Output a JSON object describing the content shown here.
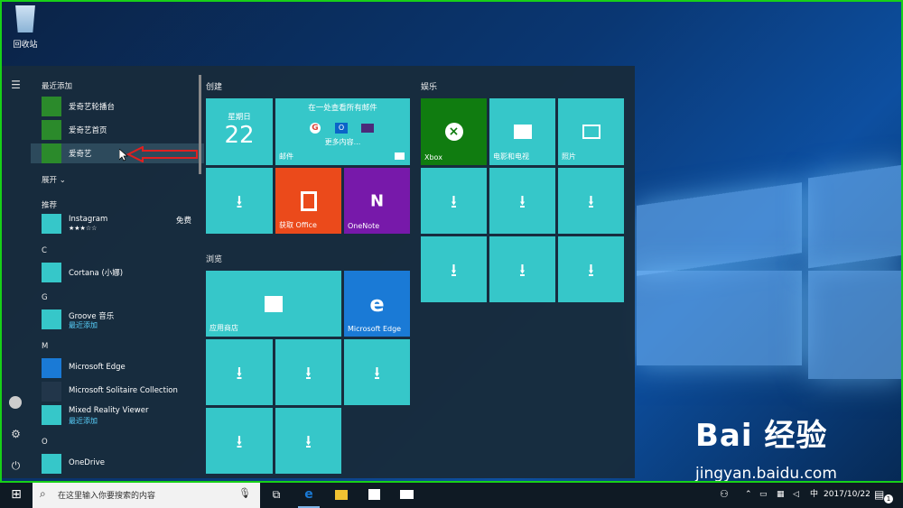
{
  "desktop": {
    "recycle_bin": "回收站"
  },
  "start_menu": {
    "recent_header": "最近添加",
    "recent_apps": [
      {
        "name": "爱奇艺轮播台"
      },
      {
        "name": "爱奇艺首页"
      },
      {
        "name": "爱奇艺"
      }
    ],
    "expand": "展开",
    "recommended_header": "推荐",
    "instagram": {
      "name": "Instagram",
      "price": "免费",
      "stars": "★★★☆☆"
    },
    "section_c": "C",
    "cortana": "Cortana (小娜)",
    "section_g": "G",
    "groove": {
      "name": "Groove 音乐",
      "sub": "最近添加"
    },
    "section_m": "M",
    "edge": "Microsoft Edge",
    "solitaire": "Microsoft Solitaire Collection",
    "mixed_reality": {
      "name": "Mixed Reality Viewer",
      "sub": "最近添加"
    },
    "section_o": "O",
    "onedrive": "OneDrive"
  },
  "tiles": {
    "group_create": "创建",
    "calendar": {
      "day": "星期日",
      "date": "22"
    },
    "mail": {
      "top": "在一处查看所有邮件",
      "more": "更多内容...",
      "name": "邮件"
    },
    "office": "获取 Office",
    "onenote": "OneNote",
    "group_browse": "浏览",
    "store": "应用商店",
    "edge": "Microsoft Edge",
    "group_play": "娱乐",
    "xbox": "Xbox",
    "movies": "电影和电视",
    "photos": "照片"
  },
  "taskbar": {
    "search_placeholder": "在这里输入你要搜索的内容",
    "ime": "中",
    "time": "2017/10/22",
    "notification_count": "1"
  },
  "watermark": {
    "brand": "Bai 经验",
    "url": "jingyan.baidu.com"
  },
  "colors": {
    "tile": "#36c7c9",
    "office": "#eb4a1b",
    "onenote": "#7719aa",
    "xbox": "#107c10",
    "edge_blue": "#1a7ad6",
    "frame": "#18d018",
    "arrow": "#e02020"
  }
}
